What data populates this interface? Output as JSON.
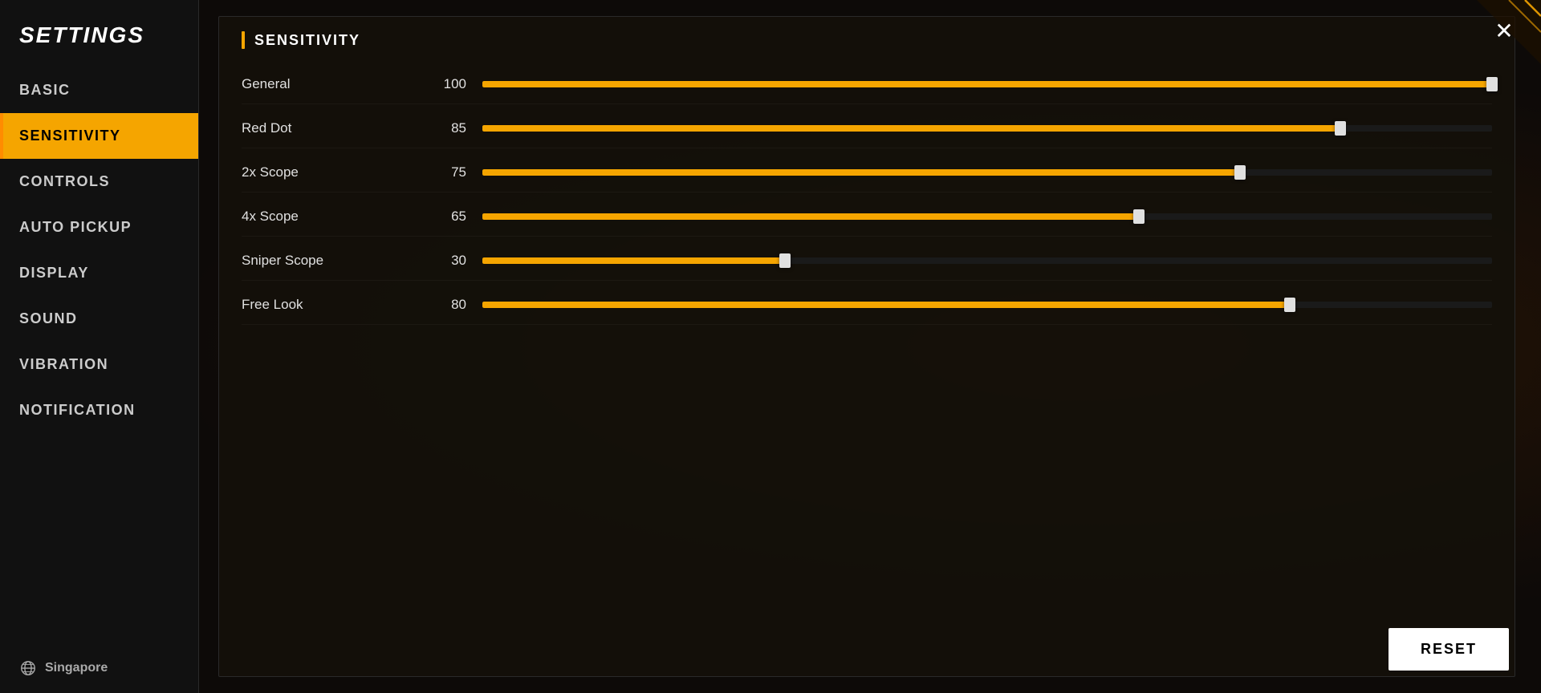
{
  "sidebar": {
    "title": "SETTINGS",
    "items": [
      {
        "id": "basic",
        "label": "BASIC",
        "active": false
      },
      {
        "id": "sensitivity",
        "label": "SENSITIVITY",
        "active": true
      },
      {
        "id": "controls",
        "label": "CONTROLS",
        "active": false
      },
      {
        "id": "auto-pickup",
        "label": "AUTO PICKUP",
        "active": false
      },
      {
        "id": "display",
        "label": "DISPLAY",
        "active": false
      },
      {
        "id": "sound",
        "label": "SOUND",
        "active": false
      },
      {
        "id": "vibration",
        "label": "VIBRATION",
        "active": false
      },
      {
        "id": "notification",
        "label": "NOTIFICATION",
        "active": false
      }
    ],
    "region_icon": "globe-icon",
    "region_label": "Singapore"
  },
  "panel": {
    "title": "SENSITIVITY",
    "sliders": [
      {
        "label": "General",
        "value": 100,
        "percent": 100
      },
      {
        "label": "Red Dot",
        "value": 85,
        "percent": 85
      },
      {
        "label": "2x Scope",
        "value": 75,
        "percent": 75
      },
      {
        "label": "4x Scope",
        "value": 65,
        "percent": 65
      },
      {
        "label": "Sniper Scope",
        "value": 30,
        "percent": 30
      },
      {
        "label": "Free Look",
        "value": 80,
        "percent": 80
      }
    ]
  },
  "buttons": {
    "close_label": "✕",
    "reset_label": "RESET"
  }
}
